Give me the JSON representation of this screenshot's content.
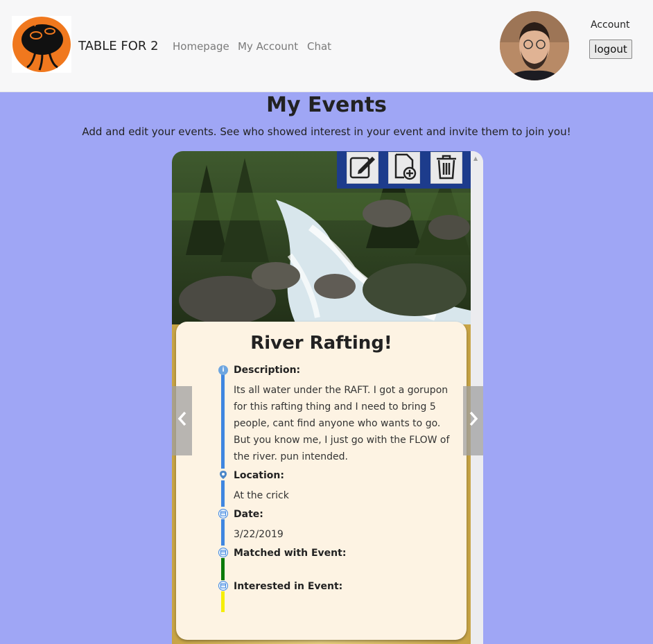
{
  "navbar": {
    "brand": "TABLE FOR 2",
    "links": [
      "Homepage",
      "My Account",
      "Chat"
    ],
    "account_label": "Account",
    "logout_label": "logout"
  },
  "header": {
    "title": "My Events",
    "subtitle": "Add and edit your events. See who showed interest in your event and invite them to join you!"
  },
  "toolbar": {
    "icons": [
      "edit-icon",
      "add-document-icon",
      "trash-icon"
    ]
  },
  "event": {
    "title": "River Rafting!",
    "description_label": "Description:",
    "description": " Its all water under the RAFT. I got a gorupon for this rafting thing and I need to bring 5 people, cant find anyone who wants to go. But you know me, I just go with the FLOW of the river. pun intended.",
    "location_label": "Location:",
    "location": "At the crick",
    "date_label": "Date:",
    "date": "3/22/2019",
    "matched_label": "Matched with Event:",
    "interested_label": "Interested in Event:"
  },
  "colors": {
    "background": "#9fa6f5",
    "timeline_blue": "#3f86e0",
    "timeline_green": "#0a7a0a",
    "timeline_yellow": "#f5ee08",
    "panel": "#fdf3e3"
  }
}
